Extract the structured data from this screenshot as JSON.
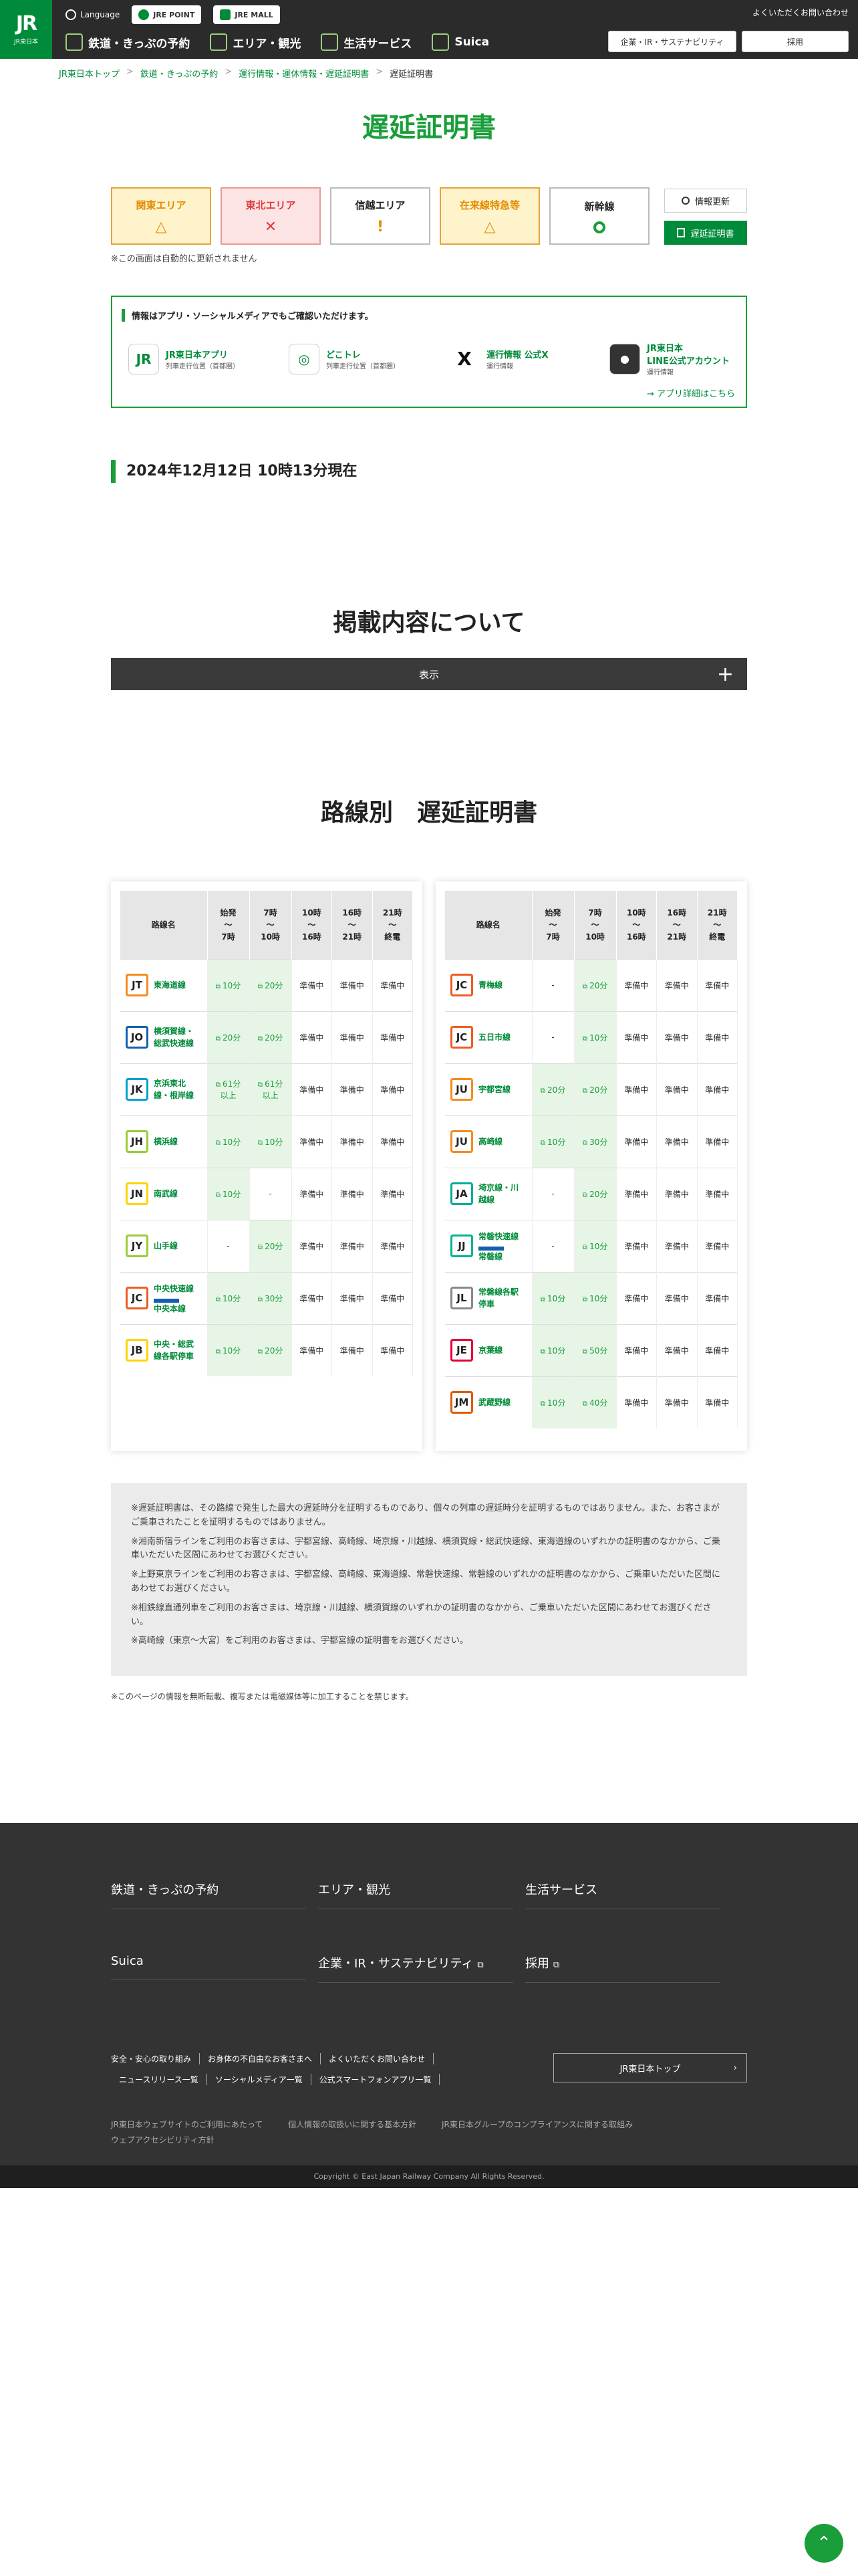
{
  "header": {
    "logo_text": "JR",
    "logo_sub": "JR東日本",
    "language": "Language",
    "jre_point": "JRE POINT",
    "jre_mall": "JRE MALL",
    "faq": "よくいただくお問い合わせ",
    "nav": [
      "鉄道・きっぷの予約",
      "エリア・観光",
      "生活サービス",
      "Suica"
    ],
    "corp_btn": "企業・IR・サステナビリティ",
    "recruit_btn": "採用"
  },
  "breadcrumb": [
    "JR東日本トップ",
    "鉄道・きっぷの予約",
    "運行情報・運休情報・遅延証明書",
    "遅延証明書"
  ],
  "page_title": "遅延証明書",
  "areas": [
    {
      "label": "関東エリア",
      "status": "warn",
      "symbol": "△"
    },
    {
      "label": "東北エリア",
      "status": "stop",
      "symbol": "✕"
    },
    {
      "label": "信越エリア",
      "status": "info",
      "symbol": "!"
    },
    {
      "label": "在来線特急等",
      "status": "warn",
      "symbol": "△"
    },
    {
      "label": "新幹線",
      "status": "ok",
      "symbol": "○"
    }
  ],
  "refresh_btn": "情報更新",
  "cert_btn": "遅延証明書",
  "auto_note": "※この画面は自動的に更新されません",
  "apps_box": {
    "heading": "情報はアプリ・ソーシャルメディアでもご確認いただけます。",
    "apps": [
      {
        "name": "JR東日本アプリ",
        "sub": "列車走行位置（首都圏）",
        "icon": "JR"
      },
      {
        "name": "どこトレ",
        "sub": "列車走行位置（首都圏）",
        "icon": "◎"
      },
      {
        "name": "運行情報 公式X",
        "sub": "運行情報",
        "icon": "X"
      },
      {
        "name": "JR東日本\nLINE公式アカウント",
        "sub": "運行情報",
        "icon": "●"
      }
    ],
    "more": "→ アプリ詳細はこちら"
  },
  "timestamp": "2024年12月12日 10時13分現在",
  "about_title": "掲載内容について",
  "display_btn": "表示",
  "lines_title": "路線別　遅延証明書",
  "table_headers": {
    "line": "路線名",
    "cols": [
      "始発\n〜\n7時",
      "7時\n〜\n10時",
      "10時\n〜\n16時",
      "16時\n〜\n21時",
      "21時\n〜\n終電"
    ]
  },
  "left_lines": [
    {
      "code": "JT",
      "color": "#f68b1e",
      "name": "東海道線",
      "vals": [
        "10分",
        "20分",
        "準備中",
        "準備中",
        "準備中"
      ]
    },
    {
      "code": "JO",
      "color": "#1060b0",
      "name": "横須賀線・\n総武快速線",
      "vals": [
        "20分",
        "20分",
        "準備中",
        "準備中",
        "準備中"
      ]
    },
    {
      "code": "JK",
      "color": "#00a0d0",
      "name": "京浜東北\n線・根岸線",
      "vals": [
        "61分\n以上",
        "61分\n以上",
        "準備中",
        "準備中",
        "準備中"
      ]
    },
    {
      "code": "JH",
      "color": "#9acd32",
      "name": "横浜線",
      "vals": [
        "10分",
        "10分",
        "準備中",
        "準備中",
        "準備中"
      ]
    },
    {
      "code": "JN",
      "color": "#ffd400",
      "name": "南武線",
      "vals": [
        "10分",
        "-",
        "準備中",
        "準備中",
        "準備中"
      ]
    },
    {
      "code": "JY",
      "color": "#9acd32",
      "name": "山手線",
      "vals": [
        "-",
        "20分",
        "準備中",
        "準備中",
        "準備中"
      ]
    },
    {
      "code": "JC",
      "color": "#f15a22",
      "name": "中央快速線",
      "name2": "中央本線",
      "vals": [
        "10分",
        "30分",
        "準備中",
        "準備中",
        "準備中"
      ]
    },
    {
      "code": "JB",
      "color": "#ffd400",
      "name": "中央・総武\n線各駅停車",
      "vals": [
        "10分",
        "20分",
        "準備中",
        "準備中",
        "準備中"
      ]
    }
  ],
  "right_lines": [
    {
      "code": "JC",
      "color": "#f15a22",
      "name": "青梅線",
      "vals": [
        "-",
        "20分",
        "準備中",
        "準備中",
        "準備中"
      ]
    },
    {
      "code": "JC",
      "color": "#f15a22",
      "name": "五日市線",
      "vals": [
        "-",
        "10分",
        "準備中",
        "準備中",
        "準備中"
      ]
    },
    {
      "code": "JU",
      "color": "#f68b1e",
      "name": "宇都宮線",
      "vals": [
        "20分",
        "20分",
        "準備中",
        "準備中",
        "準備中"
      ]
    },
    {
      "code": "JU",
      "color": "#f68b1e",
      "name": "高崎線",
      "vals": [
        "10分",
        "30分",
        "準備中",
        "準備中",
        "準備中"
      ]
    },
    {
      "code": "JA",
      "color": "#00ac9a",
      "name": "埼京線・川\n越線",
      "vals": [
        "-",
        "20分",
        "準備中",
        "準備中",
        "準備中"
      ]
    },
    {
      "code": "JJ",
      "color": "#00b48d",
      "name": "常磐快速線",
      "name2": "常磐線",
      "vals": [
        "-",
        "10分",
        "準備中",
        "準備中",
        "準備中"
      ]
    },
    {
      "code": "JL",
      "color": "#888888",
      "name": "常磐線各駅\n停車",
      "vals": [
        "10分",
        "10分",
        "準備中",
        "準備中",
        "準備中"
      ]
    },
    {
      "code": "JE",
      "color": "#e60033",
      "name": "京葉線",
      "vals": [
        "10分",
        "50分",
        "準備中",
        "準備中",
        "準備中"
      ]
    },
    {
      "code": "JM",
      "color": "#e05a00",
      "name": "武蔵野線",
      "vals": [
        "10分",
        "40分",
        "準備中",
        "準備中",
        "準備中"
      ]
    }
  ],
  "notes": [
    "※遅延証明書は、その路線で発生した最大の遅延時分を証明するものであり、個々の列車の遅延時分を証明するものではありません。また、お客さまがご乗車されたことを証明するものではありません。",
    "※湘南新宿ラインをご利用のお客さまは、宇都宮線、高崎線、埼京線・川越線、横須賀線・総武快速線、東海道線のいずれかの証明書のなかから、ご乗車いただいた区間にあわせてお選びください。",
    "※上野東京ラインをご利用のお客さまは、宇都宮線、高崎線、東海道線、常磐快速線、常磐線のいずれかの証明書のなかから、ご乗車いただいた区間にあわせてお選びください。",
    "※相鉄線直通列車をご利用のお客さまは、埼京線・川越線、横須賀線のいずれかの証明書のなかから、ご乗車いただいた区間にあわせてお選びください。",
    "※高崎線（東京〜大宮）をご利用のお客さまは、宇都宮線の証明書をお選びください。"
  ],
  "copy_note": "※このページの情報を無断転載、複写または電磁媒体等に加工することを禁じます。",
  "footer": {
    "cols": [
      "鉄道・きっぷの予約",
      "エリア・観光",
      "生活サービス",
      "Suica",
      "企業・IR・サステナビリティ",
      "採用"
    ],
    "links": [
      "安全・安心の取り組み",
      "お身体の不自由なお客さまへ",
      "よくいただくお問い合わせ",
      "ニュースリリース一覧",
      "ソーシャルメディア一覧",
      "公式スマートフォンアプリ一覧"
    ],
    "sublinks": [
      "JR東日本ウェブサイトのご利用にあたって",
      "個人情報の取扱いに関する基本方針",
      "JR東日本グループのコンプライアンスに関する取組み",
      "ウェブアクセシビリティ方針"
    ],
    "top_btn": "JR東日本トップ",
    "copyright": "Copyright © East Japan Railway Company All Rights Reserved."
  }
}
